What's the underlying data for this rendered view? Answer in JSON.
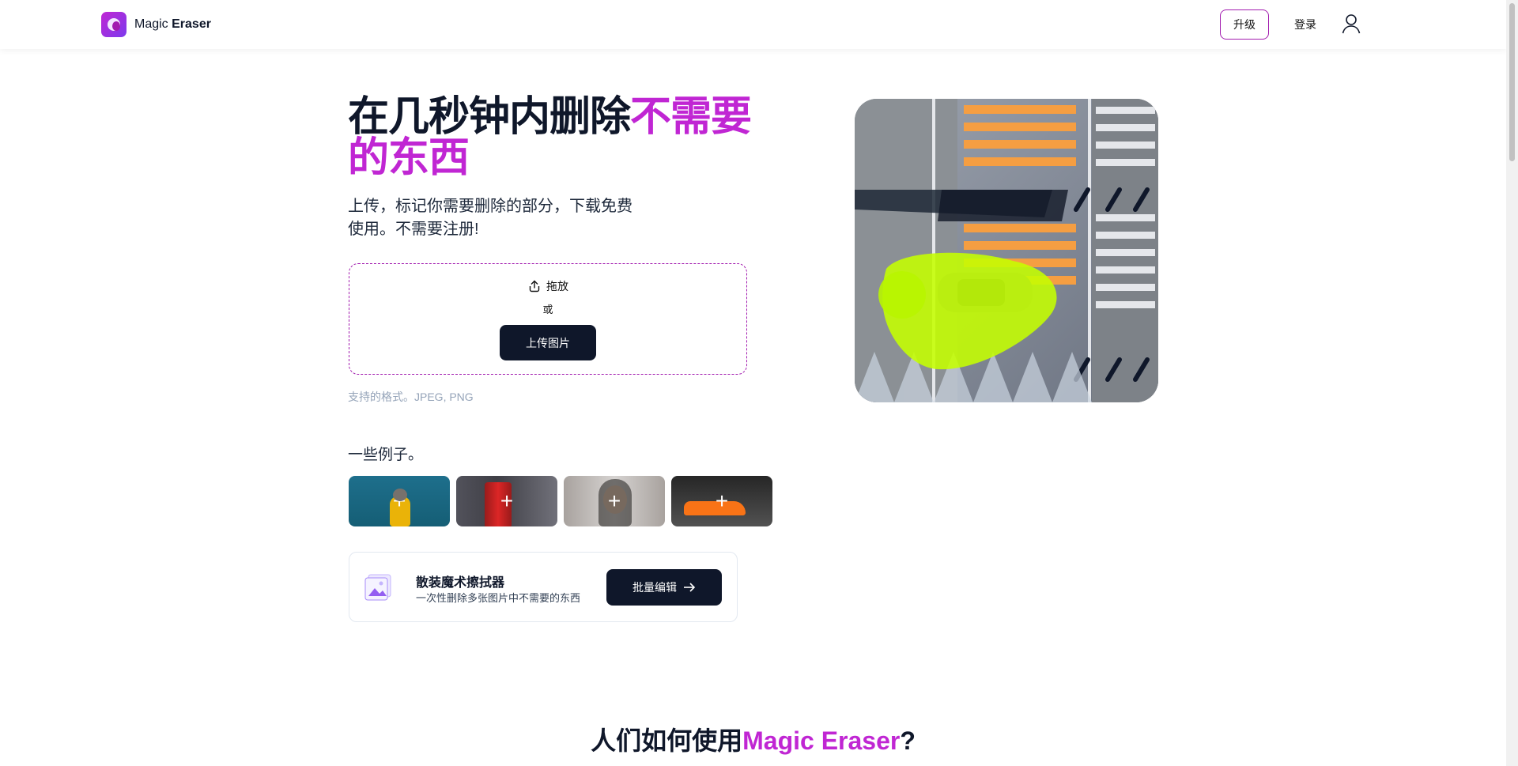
{
  "header": {
    "logo_text_light": "Magic ",
    "logo_text_bold": "Eraser",
    "upgrade_label": "升级",
    "login_label": "登录"
  },
  "hero": {
    "title_part1": "在几秒钟内删除",
    "title_accent": "不需要的东西",
    "subtitle": "上传，标记你需要删除的部分，下载免费使用。不需要注册!",
    "drag_label": "拖放",
    "or_label": "或",
    "upload_button": "上传图片",
    "formats": "支持的格式。JPEG, PNG"
  },
  "examples": {
    "label": "一些例子。",
    "items": [
      {
        "name": "cat",
        "icon": "plus-icon"
      },
      {
        "name": "cola",
        "icon": "plus-icon"
      },
      {
        "name": "woman",
        "icon": "plus-icon"
      },
      {
        "name": "car",
        "icon": "plus-icon"
      }
    ]
  },
  "batch": {
    "title": "散装魔术擦拭器",
    "description": "一次性删除多张图片中不需要的东西",
    "button": "批量编辑",
    "button_icon": "arrow-right-icon"
  },
  "section": {
    "title_part1": "人们如何使用",
    "title_accent": "Magic Eraser",
    "title_end": "?"
  },
  "colors": {
    "accent": "#c026d3",
    "dark": "#0f172a",
    "highlight": "#c5ff00"
  }
}
